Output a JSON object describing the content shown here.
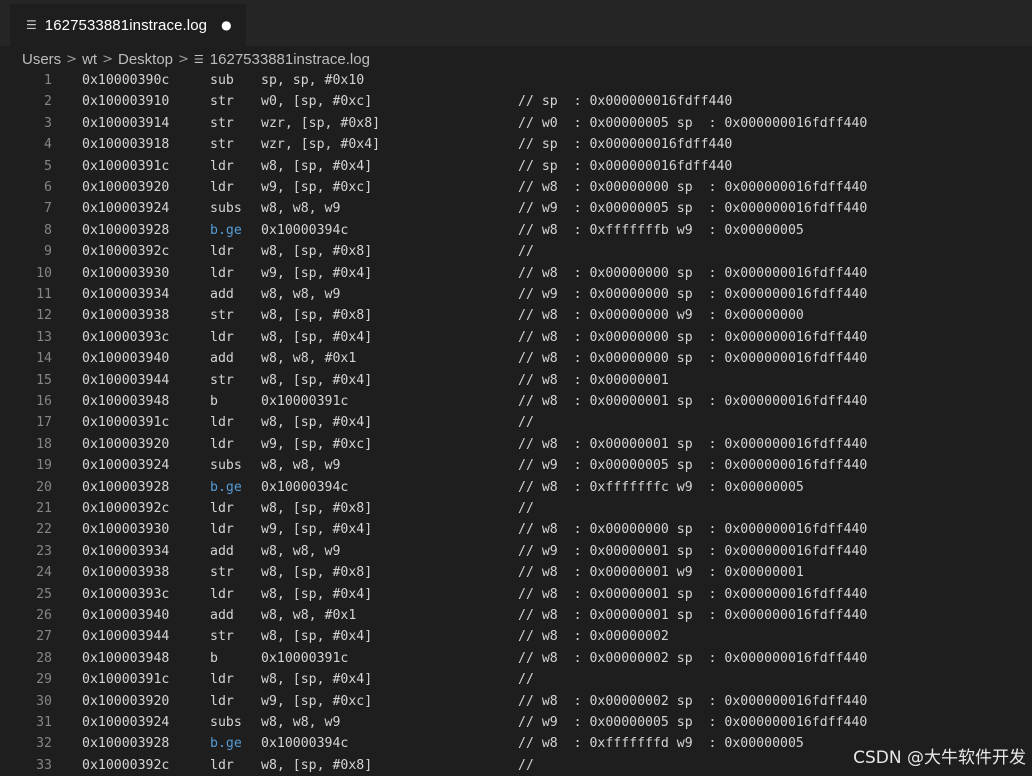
{
  "tab": {
    "icon": "lines-file-icon",
    "title": "1627533881instrace.log",
    "dirty_marker": "●"
  },
  "breadcrumb": {
    "items": [
      "Users",
      "wt",
      "Desktop"
    ],
    "separator": ">",
    "file": "1627533881instrace.log"
  },
  "lines": [
    {
      "n": "1",
      "addr": "0x10000390c",
      "op": "sub",
      "args": "sp, sp, #0x10",
      "cmt": ""
    },
    {
      "n": "2",
      "addr": "0x100003910",
      "op": "str",
      "args": "w0, [sp, #0xc]",
      "cmt": "// sp  : 0x000000016fdff440"
    },
    {
      "n": "3",
      "addr": "0x100003914",
      "op": "str",
      "args": "wzr, [sp, #0x8]",
      "cmt": "// w0  : 0x00000005 sp  : 0x000000016fdff440"
    },
    {
      "n": "4",
      "addr": "0x100003918",
      "op": "str",
      "args": "wzr, [sp, #0x4]",
      "cmt": "// sp  : 0x000000016fdff440"
    },
    {
      "n": "5",
      "addr": "0x10000391c",
      "op": "ldr",
      "args": "w8, [sp, #0x4]",
      "cmt": "// sp  : 0x000000016fdff440"
    },
    {
      "n": "6",
      "addr": "0x100003920",
      "op": "ldr",
      "args": "w9, [sp, #0xc]",
      "cmt": "// w8  : 0x00000000 sp  : 0x000000016fdff440"
    },
    {
      "n": "7",
      "addr": "0x100003924",
      "op": "subs",
      "args": "w8, w8, w9",
      "cmt": "// w9  : 0x00000005 sp  : 0x000000016fdff440"
    },
    {
      "n": "8",
      "addr": "0x100003928",
      "op": "b.ge",
      "args": "0x10000394c",
      "cmt": "// w8  : 0xfffffffb w9  : 0x00000005"
    },
    {
      "n": "9",
      "addr": "0x10000392c",
      "op": "ldr",
      "args": "w8, [sp, #0x8]",
      "cmt": "//"
    },
    {
      "n": "10",
      "addr": "0x100003930",
      "op": "ldr",
      "args": "w9, [sp, #0x4]",
      "cmt": "// w8  : 0x00000000 sp  : 0x000000016fdff440"
    },
    {
      "n": "11",
      "addr": "0x100003934",
      "op": "add",
      "args": "w8, w8, w9",
      "cmt": "// w9  : 0x00000000 sp  : 0x000000016fdff440"
    },
    {
      "n": "12",
      "addr": "0x100003938",
      "op": "str",
      "args": "w8, [sp, #0x8]",
      "cmt": "// w8  : 0x00000000 w9  : 0x00000000"
    },
    {
      "n": "13",
      "addr": "0x10000393c",
      "op": "ldr",
      "args": "w8, [sp, #0x4]",
      "cmt": "// w8  : 0x00000000 sp  : 0x000000016fdff440"
    },
    {
      "n": "14",
      "addr": "0x100003940",
      "op": "add",
      "args": "w8, w8, #0x1",
      "cmt": "// w8  : 0x00000000 sp  : 0x000000016fdff440"
    },
    {
      "n": "15",
      "addr": "0x100003944",
      "op": "str",
      "args": "w8, [sp, #0x4]",
      "cmt": "// w8  : 0x00000001"
    },
    {
      "n": "16",
      "addr": "0x100003948",
      "op": "b",
      "args": "0x10000391c",
      "cmt": "// w8  : 0x00000001 sp  : 0x000000016fdff440"
    },
    {
      "n": "17",
      "addr": "0x10000391c",
      "op": "ldr",
      "args": "w8, [sp, #0x4]",
      "cmt": "//"
    },
    {
      "n": "18",
      "addr": "0x100003920",
      "op": "ldr",
      "args": "w9, [sp, #0xc]",
      "cmt": "// w8  : 0x00000001 sp  : 0x000000016fdff440"
    },
    {
      "n": "19",
      "addr": "0x100003924",
      "op": "subs",
      "args": "w8, w8, w9",
      "cmt": "// w9  : 0x00000005 sp  : 0x000000016fdff440"
    },
    {
      "n": "20",
      "addr": "0x100003928",
      "op": "b.ge",
      "args": "0x10000394c",
      "cmt": "// w8  : 0xfffffffc w9  : 0x00000005"
    },
    {
      "n": "21",
      "addr": "0x10000392c",
      "op": "ldr",
      "args": "w8, [sp, #0x8]",
      "cmt": "//"
    },
    {
      "n": "22",
      "addr": "0x100003930",
      "op": "ldr",
      "args": "w9, [sp, #0x4]",
      "cmt": "// w8  : 0x00000000 sp  : 0x000000016fdff440"
    },
    {
      "n": "23",
      "addr": "0x100003934",
      "op": "add",
      "args": "w8, w8, w9",
      "cmt": "// w9  : 0x00000001 sp  : 0x000000016fdff440"
    },
    {
      "n": "24",
      "addr": "0x100003938",
      "op": "str",
      "args": "w8, [sp, #0x8]",
      "cmt": "// w8  : 0x00000001 w9  : 0x00000001"
    },
    {
      "n": "25",
      "addr": "0x10000393c",
      "op": "ldr",
      "args": "w8, [sp, #0x4]",
      "cmt": "// w8  : 0x00000001 sp  : 0x000000016fdff440"
    },
    {
      "n": "26",
      "addr": "0x100003940",
      "op": "add",
      "args": "w8, w8, #0x1",
      "cmt": "// w8  : 0x00000001 sp  : 0x000000016fdff440"
    },
    {
      "n": "27",
      "addr": "0x100003944",
      "op": "str",
      "args": "w8, [sp, #0x4]",
      "cmt": "// w8  : 0x00000002"
    },
    {
      "n": "28",
      "addr": "0x100003948",
      "op": "b",
      "args": "0x10000391c",
      "cmt": "// w8  : 0x00000002 sp  : 0x000000016fdff440"
    },
    {
      "n": "29",
      "addr": "0x10000391c",
      "op": "ldr",
      "args": "w8, [sp, #0x4]",
      "cmt": "//"
    },
    {
      "n": "30",
      "addr": "0x100003920",
      "op": "ldr",
      "args": "w9, [sp, #0xc]",
      "cmt": "// w8  : 0x00000002 sp  : 0x000000016fdff440"
    },
    {
      "n": "31",
      "addr": "0x100003924",
      "op": "subs",
      "args": "w8, w8, w9",
      "cmt": "// w9  : 0x00000005 sp  : 0x000000016fdff440"
    },
    {
      "n": "32",
      "addr": "0x100003928",
      "op": "b.ge",
      "args": "0x10000394c",
      "cmt": "// w8  : 0xfffffffd w9  : 0x00000005"
    },
    {
      "n": "33",
      "addr": "0x10000392c",
      "op": "ldr",
      "args": "w8, [sp, #0x8]",
      "cmt": "//"
    }
  ],
  "watermark": "CSDN @大牛软件开发",
  "colors": {
    "background": "#1e1e1e",
    "tabbar": "#252526",
    "text": "#d4d4d4",
    "line_number": "#858585",
    "branch_keyword": "#569cd6"
  }
}
